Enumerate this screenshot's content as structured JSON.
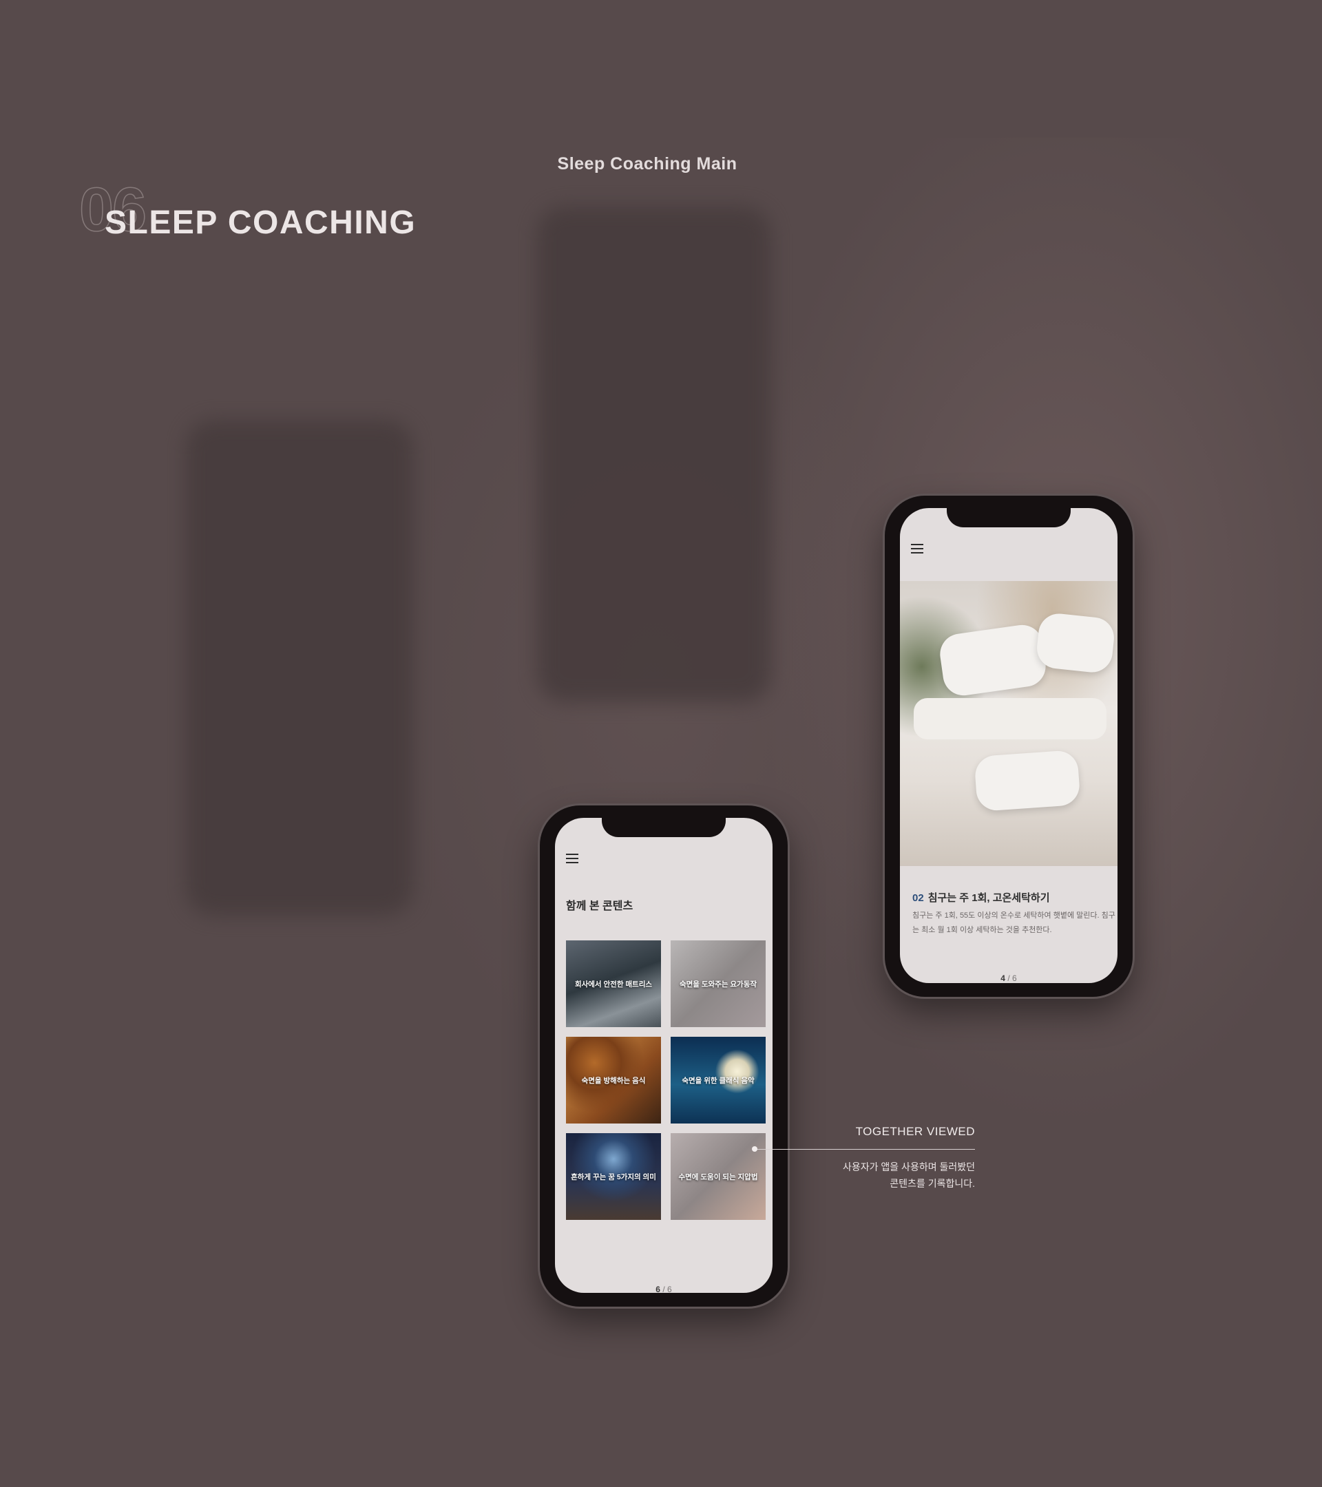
{
  "section": {
    "number": "06",
    "title": "SLEEP COACHING"
  },
  "screen_label": "Sleep Coaching Main",
  "right_phone": {
    "tip_number": "02",
    "tip_title": "침구는 주 1회, 고온세탁하기",
    "tip_desc": "침구는 주 1회, 55도 이상의 온수로 세탁하여 햇볕에 말린다. 침구는 최소 월 1회 이상 세탁하는 것을 추천한다.",
    "pager_current": "4",
    "pager_sep": "/",
    "pager_total": "6"
  },
  "bottom_phone": {
    "heading": "함께 본 콘텐츠",
    "tiles": [
      {
        "label": "회사에서 안전한 매트리스"
      },
      {
        "label": "숙면을 도와주는 요가동작"
      },
      {
        "label": "숙면을 방해하는 음식"
      },
      {
        "label": "숙면을 위한 클래식 음악"
      },
      {
        "label": "흔하게 꾸는 꿈 5가지의 의미"
      },
      {
        "label": "수면에 도움이 되는 지압법"
      }
    ],
    "back_icon": "chevron-left-icon",
    "back_glyph": "‹",
    "pager_current": "6",
    "pager_sep": "/",
    "pager_total": "6"
  },
  "callout": {
    "title": "TOGETHER VIEWED",
    "desc_line1": "사용자가 앱을 사용하며 둘러봤던",
    "desc_line2": "콘텐츠를 기록합니다."
  },
  "colors": {
    "background": "#574a4b",
    "screen": "#e2dddd",
    "accent_number": "#2d4e7a"
  }
}
